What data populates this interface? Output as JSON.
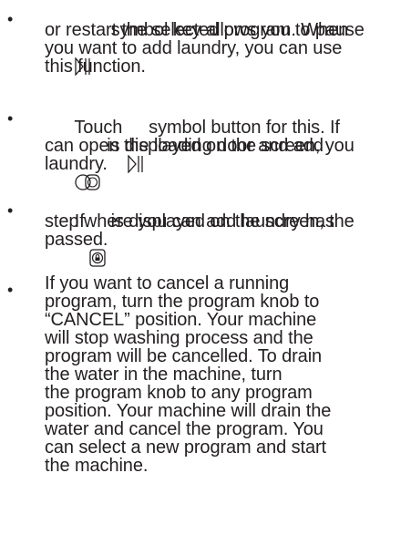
{
  "instructions": [
    {
      "lines": [
        {
          "icon": "pause-play",
          "text": "    symbol key allows you to pause"
        },
        {
          "text": "or restart the selected program. When"
        },
        {
          "text": "you want to add laundry, you can use"
        },
        {
          "text": "this function."
        }
      ]
    },
    {
      "lines": [
        {
          "pre": "Touch ",
          "icon": "pause-play",
          "text": " symbol button for this. If"
        },
        {
          "icon": "door-open",
          "text": " is displayed on the screen, you"
        },
        {
          "text": "can open the loading door and add"
        },
        {
          "text": "laundry."
        }
      ]
    },
    {
      "lines": [
        {
          "pre": "If ",
          "icon": "door-lock",
          "text": " is displayed on the screen, the"
        },
        {
          "text": "step where you can add laundry has"
        },
        {
          "text": "passed."
        }
      ]
    },
    {
      "lines": [
        {
          "text": "If you want to cancel a running"
        },
        {
          "text": "program, turn the program knob to"
        },
        {
          "text": "“CANCEL” position. Your machine"
        },
        {
          "text": "will stop washing process and the"
        },
        {
          "text": "program will be cancelled. To drain"
        },
        {
          "text": "the water in the machine, turn"
        },
        {
          "text": "the program knob to any program"
        },
        {
          "text": "position. Your machine will drain the"
        },
        {
          "text": "water and cancel the program. You"
        },
        {
          "text": "can select a new program and start"
        },
        {
          "text": "the machine."
        }
      ]
    }
  ],
  "bullet_char": "•"
}
